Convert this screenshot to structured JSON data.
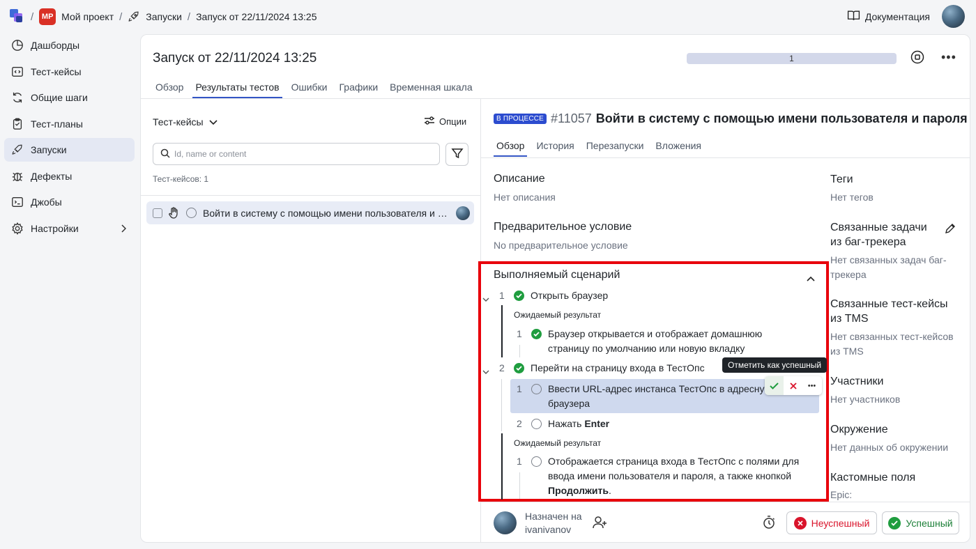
{
  "breadcrumb": {
    "project_badge": "MP",
    "project": "Мой проект",
    "launches": "Запуски",
    "run": "Запуск от 22/11/2024 13:25"
  },
  "header": {
    "docs": "Документация"
  },
  "sidebar": {
    "items": [
      {
        "label": "Дашборды",
        "icon": "dashboard-icon"
      },
      {
        "label": "Тест-кейсы",
        "icon": "code-icon"
      },
      {
        "label": "Общие шаги",
        "icon": "refresh-icon"
      },
      {
        "label": "Тест-планы",
        "icon": "clipboard-icon"
      },
      {
        "label": "Запуски",
        "icon": "rocket-icon",
        "active": true
      },
      {
        "label": "Дефекты",
        "icon": "bug-icon"
      },
      {
        "label": "Джобы",
        "icon": "terminal-icon"
      },
      {
        "label": "Настройки",
        "icon": "gear-icon"
      }
    ]
  },
  "run": {
    "title": "Запуск от 22/11/2024 13:25",
    "progress_label": "1",
    "tabs": [
      "Обзор",
      "Результаты тестов",
      "Ошибки",
      "Графики",
      "Временная шкала"
    ],
    "active_tab": "Результаты тестов"
  },
  "testcases": {
    "heading": "Тест-кейсы",
    "options": "Опции",
    "search_placeholder": "Id, name or content",
    "count": "Тест-кейсов: 1",
    "items": [
      {
        "name": "Войти в систему с помощью имени пользователя и пароля"
      }
    ]
  },
  "detail": {
    "status": "В ПРОЦЕССЕ",
    "id": "#11057",
    "title": "Войти в систему с помощью имени пользователя и пароля",
    "tabs": [
      "Обзор",
      "История",
      "Перезапуски",
      "Вложения"
    ],
    "description_h": "Описание",
    "description": "Нет описания",
    "precondition_h": "Предварительное условие",
    "precondition": "No предварительное условие",
    "scenario_h": "Выполняемый сценарий",
    "expected_label": "Ожидаемый результат",
    "steps": [
      {
        "num": "1",
        "text": "Открыть браузер"
      },
      {
        "num": "2",
        "text": "Перейти на страницу входа в ТестОпс"
      }
    ],
    "step1_expected": {
      "num": "1",
      "text1": "Браузер открывается и отображает домашнюю",
      "text2": "страницу по умолчанию или новую вкладку"
    },
    "step2_sub": [
      {
        "num": "1",
        "text1": "Ввести URL-адрес инстанса ТестОпс в адресную",
        "text2": "браузера"
      },
      {
        "num": "2",
        "text_pre": "Нажать ",
        "text_bold": "Enter"
      }
    ],
    "step2_expected": {
      "num": "1",
      "text1": "Отображается страница входа в ТестОпс с полями для",
      "text2": "ввода имени пользователя и пароля, а также кнопкой",
      "text3_bold": "Продолжить",
      "text3_tail": "."
    },
    "tooltip": "Отметить как успешный"
  },
  "side": {
    "tags_h": "Теги",
    "tags": "Нет тегов",
    "issues_h1": "Связанные задачи",
    "issues_h2": "из баг-трекера",
    "issues_t1": "Нет связанных задач баг-",
    "issues_t2": "трекера",
    "tms_h1": "Связанные тест-кейсы",
    "tms_h2": "из TMS",
    "tms_t1": "Нет связанных тест-кейсов",
    "tms_t2": "из TMS",
    "members_h": "Участники",
    "members": "Нет участников",
    "env_h": "Окружение",
    "env": "Нет данных об окружении",
    "custom_h": "Кастомные поля",
    "custom": "Epic:"
  },
  "footer": {
    "assigned_label": "Назначен на",
    "assignee": "ivanivanov",
    "fail": "Неуспешный",
    "pass": "Успешный"
  },
  "colors": {
    "accent": "#3355c5",
    "success": "#1f9d3f",
    "fail": "#d9142b",
    "highlight": "#e8000b"
  }
}
